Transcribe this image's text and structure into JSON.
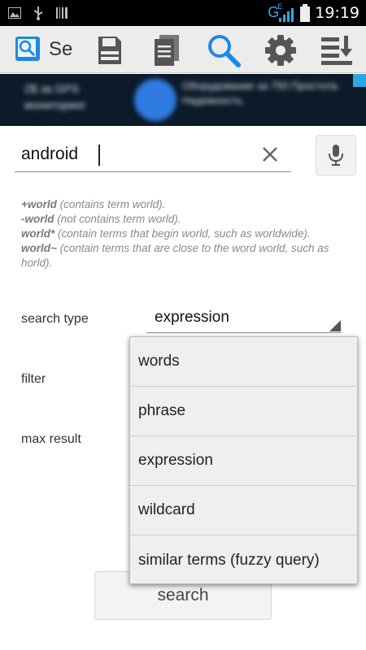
{
  "status_bar": {
    "time": "19:19",
    "network": "G",
    "network_sub": "E"
  },
  "action_bar": {
    "title": "Se",
    "icons": [
      "save-icon",
      "document-icon",
      "search-icon",
      "settings-icon",
      "sort-icon"
    ]
  },
  "ad": {
    "left_text": "2$ за GPS мониторинг",
    "right_text": "Оборудование за 750 Простота. Надежность."
  },
  "search": {
    "value": "android",
    "clear_icon": "close-icon",
    "mic_icon": "microphone-icon"
  },
  "help": [
    {
      "term": "+world",
      "desc": " (contains term world)."
    },
    {
      "term": "-world",
      "desc": " (not contains term world)."
    },
    {
      "term": "world*",
      "desc": " (contain terms that begin world, such as worldwide)."
    },
    {
      "term": "world~",
      "desc": " (contain terms that are close to the word world, such as horld)."
    }
  ],
  "form": {
    "search_type_label": "search type",
    "search_type_value": "expression",
    "filter_label": "filter",
    "max_result_label": "max result"
  },
  "dropdown": {
    "options": [
      "words",
      "phrase",
      "expression",
      "wildcard",
      "similar terms (fuzzy query)"
    ]
  },
  "search_button": "search",
  "colors": {
    "accent": "#1e88e5",
    "action_bar": "#ececec",
    "status_bar": "#000000"
  }
}
